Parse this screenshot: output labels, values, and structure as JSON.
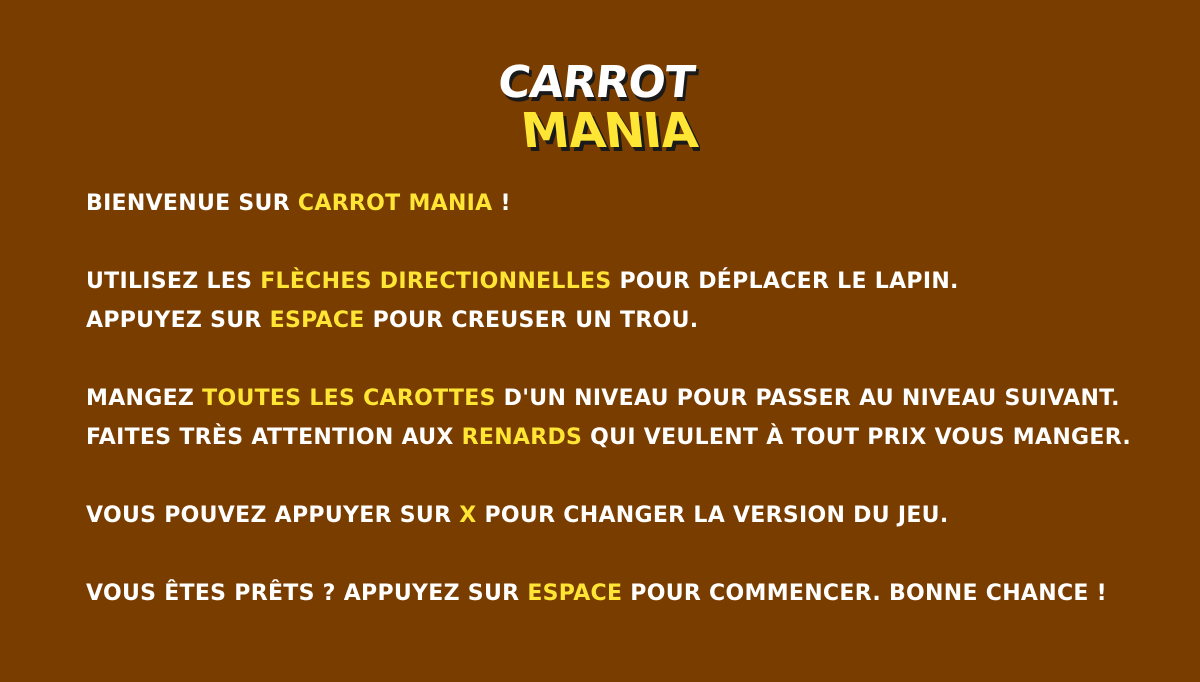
{
  "logo": {
    "line1": "CARROT",
    "line2": "MANIA",
    "colors": {
      "top": "#ffffff",
      "bottom": "#ffe534",
      "shadow": "#1a1a1a"
    }
  },
  "colors": {
    "background": "#7a3d00",
    "text": "#ffffff",
    "highlight": "#ffe534"
  },
  "instructions": {
    "welcome": {
      "pre": "Bienvenue sur ",
      "hl": "Carrot Mania",
      "post": " !"
    },
    "move": {
      "pre": "Utilisez les ",
      "hl": "flèches directionnelles",
      "post": " pour déplacer le lapin."
    },
    "dig": {
      "pre": "Appuyez sur ",
      "hl": "espace",
      "post": " pour creuser un trou."
    },
    "eat": {
      "pre": "Mangez ",
      "hl": "toutes les carottes",
      "post": " d'un niveau pour passer au niveau suivant."
    },
    "foxes": {
      "pre": "Faites très attention aux ",
      "hl": "renards",
      "post": " qui veulent à tout prix vous manger."
    },
    "version": {
      "pre": "Vous pouvez appuyer sur ",
      "hl": "X",
      "post": " pour changer la version du jeu."
    },
    "start": {
      "pre": "Vous êtes prêts ? Appuyez sur ",
      "hl": "espace",
      "post": " pour commencer. Bonne chance !"
    }
  }
}
